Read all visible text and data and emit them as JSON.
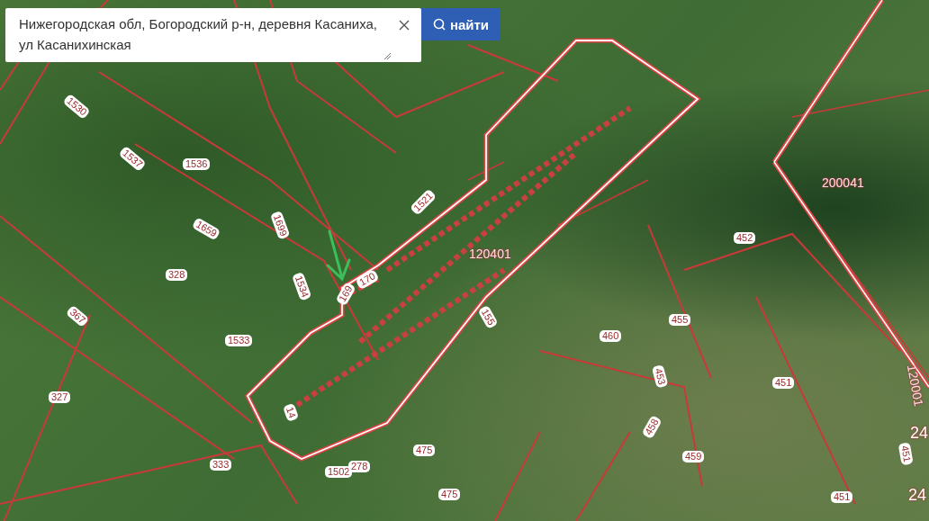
{
  "search": {
    "value": "Нижегородская обл, Богородский р-н, деревня Касаниха, ул Касанихинская",
    "button": "найти"
  },
  "map_labels": [
    {
      "text": "1530"
    },
    {
      "text": "1537"
    },
    {
      "text": "1536"
    },
    {
      "text": "1659"
    },
    {
      "text": "1699"
    },
    {
      "text": "328"
    },
    {
      "text": "1534"
    },
    {
      "text": "169"
    },
    {
      "text": "170"
    },
    {
      "text": "1521"
    },
    {
      "text": "120401"
    },
    {
      "text": "367"
    },
    {
      "text": "1533"
    },
    {
      "text": "155"
    },
    {
      "text": "327"
    },
    {
      "text": "14"
    },
    {
      "text": "333"
    },
    {
      "text": "1502"
    },
    {
      "text": "278"
    },
    {
      "text": "475"
    },
    {
      "text": "475"
    },
    {
      "text": "200041"
    },
    {
      "text": "452"
    },
    {
      "text": "455"
    },
    {
      "text": "460"
    },
    {
      "text": "453"
    },
    {
      "text": "451"
    },
    {
      "text": "458"
    },
    {
      "text": "459"
    },
    {
      "text": "451"
    },
    {
      "text": "451"
    },
    {
      "text": "120001"
    },
    {
      "text": "24"
    },
    {
      "text": "24"
    }
  ]
}
